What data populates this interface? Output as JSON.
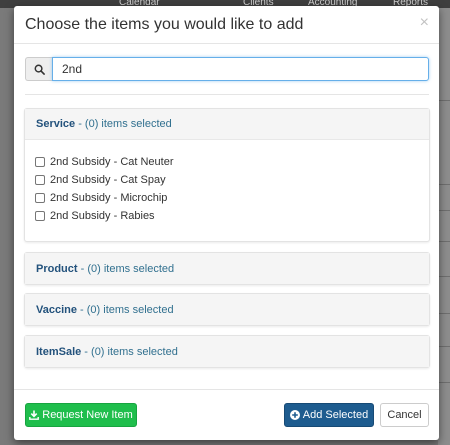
{
  "background_nav": {
    "items": [
      "Calendar",
      "Clients",
      "Accounting",
      "Reports"
    ]
  },
  "modal": {
    "title": "Choose the items you would like to add",
    "close_symbol": "×",
    "search": {
      "icon": "search-icon",
      "value": "2nd"
    },
    "panels": [
      {
        "category": "Service",
        "summary": " - (0) items selected",
        "expanded": true,
        "items": [
          {
            "label": "2nd Subsidy - Cat Neuter",
            "checked": false
          },
          {
            "label": "2nd Subsidy - Cat Spay",
            "checked": false
          },
          {
            "label": "2nd Subsidy - Microchip",
            "checked": false
          },
          {
            "label": "2nd Subsidy - Rabies",
            "checked": false
          }
        ]
      },
      {
        "category": "Product",
        "summary": " - (0) items selected",
        "expanded": false
      },
      {
        "category": "Vaccine",
        "summary": " - (0) items selected",
        "expanded": false
      },
      {
        "category": "ItemSale",
        "summary": " - (0) items selected",
        "expanded": false
      }
    ]
  },
  "footer": {
    "request_label": "Request New Item",
    "request_icon": "download-icon",
    "add_label": "Add Selected",
    "add_icon": "plus-circle-icon",
    "cancel_label": "Cancel"
  },
  "colors": {
    "request_button": "#1fbe4c",
    "add_button": "#1e5c8f",
    "panel_link": "#31708f",
    "focus_border": "#66afe9"
  }
}
